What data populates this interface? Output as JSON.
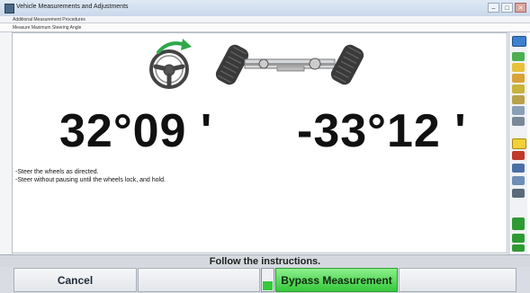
{
  "window": {
    "title": "Vehicle Measurements and Adjustments",
    "controls": {
      "minimize": "–",
      "maximize": "□",
      "close": "✕"
    }
  },
  "breadcrumb": {
    "level1": "Additional Measurement Procedures",
    "level2": "Measure Maximum Steering Angle"
  },
  "measurements": {
    "left_angle": "32°09 '",
    "right_angle": "-33°12 '"
  },
  "instructions": [
    "-Steer the wheels as directed.",
    "-Steer without pausing until the wheels lock, and hold."
  ],
  "status_message": "Follow the instructions.",
  "buttons": {
    "cancel": "Cancel",
    "empty2": "",
    "bypass": "Bypass Measurement",
    "empty4": ""
  },
  "level_meter": {
    "fill_fraction": 0.45,
    "color": "#35c93b"
  },
  "colors": {
    "accent_green": "#36c83c",
    "arrow_green": "#2fa84a"
  },
  "icons": {
    "steering": "steering-wheel-icon",
    "rotate": "rotate-arrow-icon",
    "axle": "axle-icon",
    "toolbar": [
      "help-icon",
      "vehicle-spec-icon",
      "readings-icon",
      "adjust-icon",
      "print-icon",
      "steer-angle-icon",
      "tire-icon",
      "report-icon",
      "home-icon",
      "settings-icon",
      "sensor-icon",
      "caster-icon",
      "toe-icon"
    ]
  }
}
